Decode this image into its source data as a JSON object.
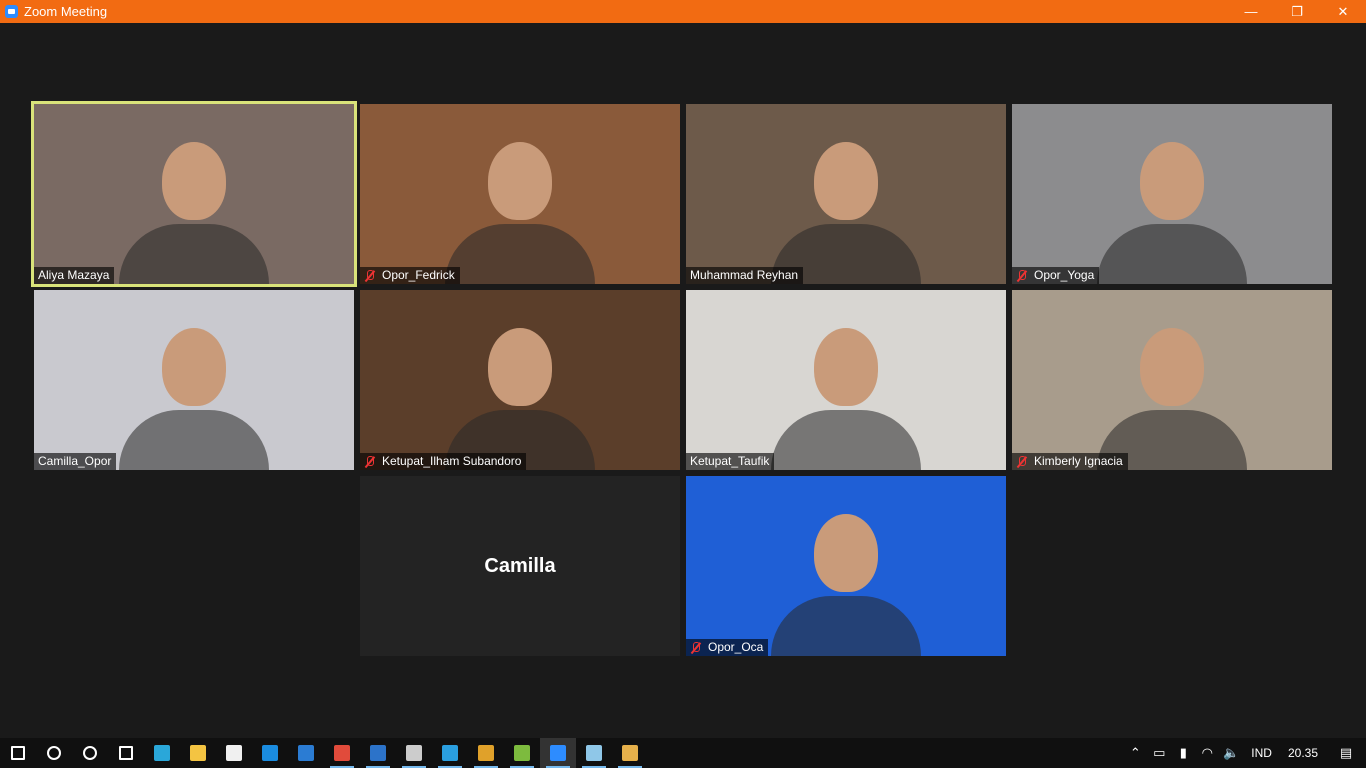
{
  "window": {
    "title": "Zoom Meeting",
    "minimize": "—",
    "restore": "❐",
    "close": "✕"
  },
  "participants": [
    {
      "name": "Aliya Mazaya",
      "muted": false,
      "active_speaker": true,
      "bg": "#7a6a63"
    },
    {
      "name": "Opor_Fedrick",
      "muted": true,
      "active_speaker": false,
      "bg": "#8a5a3a"
    },
    {
      "name": "Muhammad Reyhan",
      "muted": false,
      "active_speaker": false,
      "bg": "#6d5a4a"
    },
    {
      "name": "Opor_Yoga",
      "muted": true,
      "active_speaker": false,
      "bg": "#8c8c8e"
    },
    {
      "name": "Camilla_Opor",
      "muted": false,
      "active_speaker": false,
      "bg": "#c9c9cf"
    },
    {
      "name": "Ketupat_Ilham Subandoro",
      "muted": true,
      "active_speaker": false,
      "bg": "#5b3e2a"
    },
    {
      "name": "Ketupat_Taufik",
      "muted": false,
      "active_speaker": false,
      "bg": "#d8d6d2"
    },
    {
      "name": "Kimberly Ignacia",
      "muted": true,
      "active_speaker": false,
      "bg": "#a89c8c"
    },
    {
      "name": "Camilla",
      "video_off": true,
      "muted": false,
      "active_speaker": false,
      "bg": "#232323"
    },
    {
      "name": "Opor_Oca",
      "muted": true,
      "active_speaker": false,
      "bg": "#1f5fd6"
    }
  ],
  "taskbar": {
    "apps": [
      {
        "name": "start-icon",
        "color": "#ffffff"
      },
      {
        "name": "search-icon",
        "color": "#ffffff"
      },
      {
        "name": "cortana-icon",
        "color": "#ffffff"
      },
      {
        "name": "task-view-icon",
        "color": "#ffffff"
      },
      {
        "name": "edge-icon",
        "color": "#2aa7d9"
      },
      {
        "name": "file-explorer-icon",
        "color": "#f4c442"
      },
      {
        "name": "store-icon",
        "color": "#f0f0f0"
      },
      {
        "name": "mail-icon",
        "color": "#1a8ce0"
      },
      {
        "name": "word-icon",
        "color": "#2b7cd3"
      },
      {
        "name": "chrome-icon",
        "color": "#e14b3b"
      },
      {
        "name": "photos-icon",
        "color": "#2c73c9"
      },
      {
        "name": "terminal-icon",
        "color": "#cccccc"
      },
      {
        "name": "vscode-icon",
        "color": "#2a9fe0"
      },
      {
        "name": "git-icon",
        "color": "#e0a12a"
      },
      {
        "name": "android-icon",
        "color": "#7dbb3e"
      },
      {
        "name": "zoom-icon",
        "color": "#2d8cff"
      },
      {
        "name": "notepad-icon",
        "color": "#8fc7e8"
      },
      {
        "name": "paint-icon",
        "color": "#e5b04b"
      }
    ],
    "tray": {
      "language": "IND",
      "time": "20.35"
    }
  }
}
